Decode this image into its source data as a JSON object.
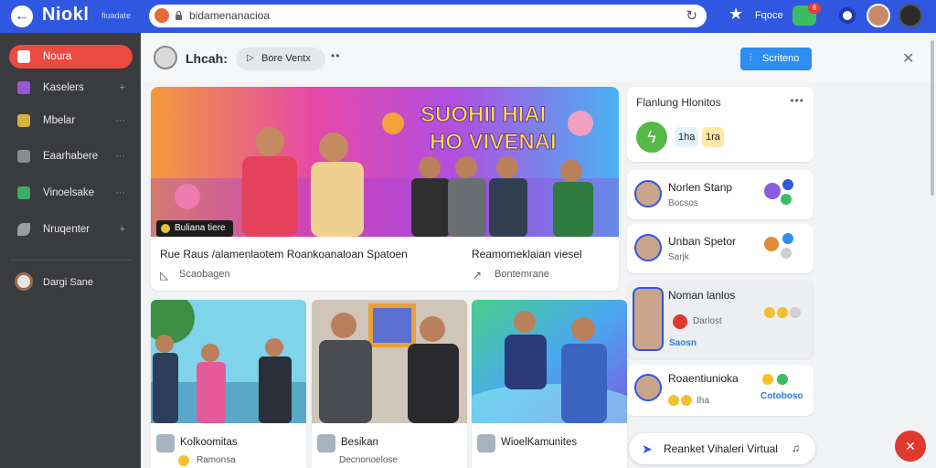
{
  "app": {
    "brand": "Niokl",
    "brand_sub": "fiuadate"
  },
  "address_bar": {
    "url": "bidamenanacioa"
  },
  "topbar": {
    "label": "Fqoce",
    "notif_count": "6"
  },
  "sidebar": {
    "items": [
      {
        "label": "Noura",
        "icon": "calendar-icon",
        "color": "#ea4a3f",
        "more": ""
      },
      {
        "label": "Kaselers",
        "icon": "puzzle-icon",
        "color": "#9a55d6",
        "more": "+"
      },
      {
        "label": "Mbelar",
        "icon": "grid-icon",
        "color": "#d7b13a",
        "more": "···"
      },
      {
        "label": "Eaarhabere",
        "icon": "folder-icon",
        "color": "#8c8d91",
        "more": "···"
      },
      {
        "label": "Vinoelsake",
        "icon": "chart-icon",
        "color": "#3cae63",
        "more": "···"
      },
      {
        "label": "Nruqenter",
        "icon": "leaf-icon",
        "color": "#9c9da2",
        "more": "+"
      }
    ],
    "user": {
      "name": "Dargi Sane"
    }
  },
  "header": {
    "title": "Lhcah:",
    "pill_label": "Bore Ventx",
    "cta_label": "Scriteno"
  },
  "feature": {
    "badge": "Buliana tiere",
    "caption_left": "Rue Raus /alamenlaotem Roankoanaloan Spatoen",
    "caption_right": "Reamomeklaian viesel",
    "meta_left": "Scaobagen",
    "meta_right": "Bontemrane",
    "banner_line1": "SUOHII HIAI",
    "banner_line2": "HO VIVENAI"
  },
  "thumbs": [
    {
      "title": "Kolkoomitas",
      "sub": "Ramonsa"
    },
    {
      "title": "Besikan",
      "sub": "Decnonoelose"
    },
    {
      "title": "WioelKamunites",
      "sub": ""
    }
  ],
  "right_panel": {
    "title": "Flanlung Hlonitos",
    "chips": [
      "1ha",
      "1ra"
    ],
    "contacts": [
      {
        "name": "Norlen Stanp",
        "sub": "Bocsos",
        "link": ""
      },
      {
        "name": "Unban Spetor",
        "sub": "Sarjk",
        "link": ""
      },
      {
        "name": "Noman lanlos",
        "sub": "Darlost",
        "link": "Saosn"
      },
      {
        "name": "Roaentiunioka",
        "sub": "Iha",
        "link": "Cotoboso"
      }
    ],
    "bottom_label": "Reanket Vihaleri Virtual"
  },
  "colors": {
    "topbar": "#2f57e0",
    "sidebar": "#3a3b3f",
    "accent_red": "#ea4a3f",
    "cta_blue": "#2d8ef0"
  }
}
